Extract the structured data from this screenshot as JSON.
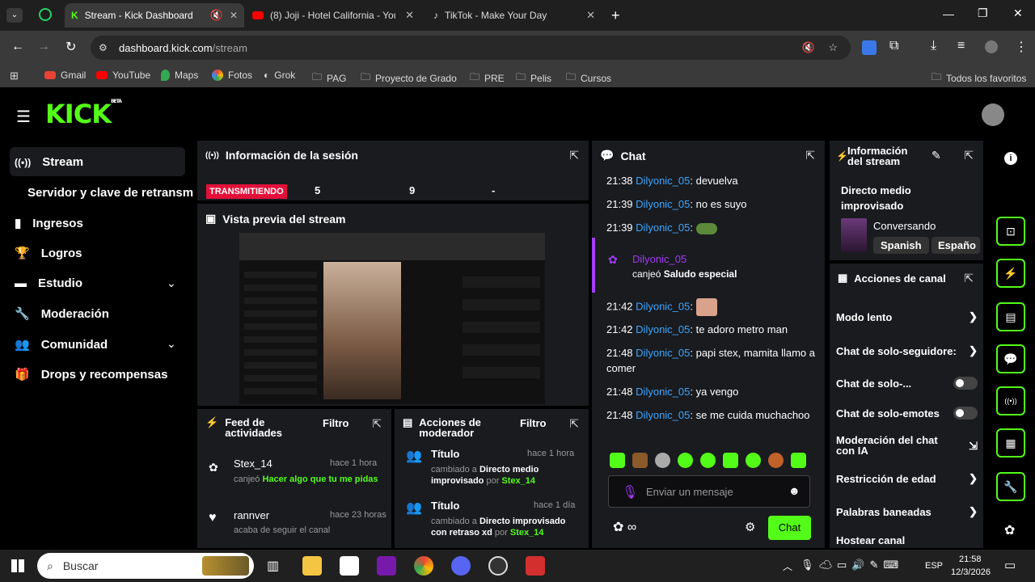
{
  "browser": {
    "tabs": [
      {
        "title": "Stream - Kick Dashboard",
        "active": true
      },
      {
        "title": "(8) Joji - Hotel California - YouT"
      },
      {
        "title": "TikTok - Make Your Day"
      }
    ],
    "url_host": "dashboard.kick.com",
    "url_path": "/stream",
    "bookmarks": [
      "Gmail",
      "YouTube",
      "Maps",
      "Fotos",
      "Grok",
      "PAG",
      "Proyecto de Grado",
      "PRE",
      "Pelis",
      "Cursos"
    ],
    "all_bookmarks": "Todos los favoritos"
  },
  "app": {
    "logo": "KICK",
    "logo_badge": "BETA"
  },
  "sidebar": {
    "items": [
      {
        "label": "Stream"
      },
      {
        "label": "Servidor y clave de retransm"
      },
      {
        "label": "Ingresos"
      },
      {
        "label": "Logros"
      },
      {
        "label": "Estudio"
      },
      {
        "label": "Moderación"
      },
      {
        "label": "Comunidad"
      },
      {
        "label": "Drops y recompensas"
      }
    ]
  },
  "session": {
    "title": "Información de la sesión",
    "status": "TRANSMITIENDO",
    "stat1": "5",
    "stat2": "9",
    "stat3": "-"
  },
  "preview": {
    "title": "Vista previa del stream"
  },
  "activity": {
    "title": "Feed de actividades",
    "filter": "Filtro",
    "items": [
      {
        "user": "Stex_14",
        "time": "hace 1 hora",
        "verb": "canjeó ",
        "reward": "Hacer algo que tu me pidas"
      },
      {
        "user": "rannver",
        "time": "hace 23 horas",
        "desc": "acaba de seguir el canal"
      }
    ]
  },
  "modactions": {
    "title": "Acciones de moderador",
    "filter": "Filtro",
    "items": [
      {
        "label": "Título",
        "time": "hace 1 hora",
        "pre": "cambiado a ",
        "value": "Directo medio improvisado",
        "by": " por ",
        "user": "Stex_14"
      },
      {
        "label": "Título",
        "time": "hace 1 día",
        "pre": "cambiado a ",
        "value": "Directo improvisado con retraso xd",
        "by": " por ",
        "user": "Stex_14"
      }
    ]
  },
  "chat": {
    "title": "Chat",
    "messages": [
      {
        "time": "21:38",
        "user": "Dilyonic_05",
        "text": ": devuelva"
      },
      {
        "time": "21:39",
        "user": "Dilyonic_05",
        "text": ": no es suyo"
      },
      {
        "time": "21:39",
        "user": "Dilyonic_05",
        "text": ":"
      },
      {
        "time": "21:42",
        "user": "Dilyonic_05",
        "text": ":"
      },
      {
        "time": "21:42",
        "user": "Dilyonic_05",
        "text": ": te adoro metro man"
      },
      {
        "time": "21:48",
        "user": "Dilyonic_05",
        "text": ": papi stex, mamita llamo a comer"
      },
      {
        "time": "21:48",
        "user": "Dilyonic_05",
        "text": ": ya vengo"
      },
      {
        "time": "21:48",
        "user": "Dilyonic_05",
        "text": ": se me cuida muchachoo"
      }
    ],
    "redeem": {
      "user": "Dilyonic_05",
      "verb": "canjeó ",
      "reward": "Saludo especial"
    },
    "placeholder": "Enviar un mensaje",
    "send": "Chat"
  },
  "streaminfo": {
    "title_line1": "Información",
    "title_line2": "del stream",
    "stream_title": "Directo medio improvisado",
    "category": "Conversando",
    "tags": [
      "Spanish",
      "Españo"
    ]
  },
  "channelactions": {
    "title": "Acciones de canal",
    "items": [
      {
        "label": "Modo lento"
      },
      {
        "label": "Chat de solo-seguidore:"
      },
      {
        "label": "Chat de solo-..."
      },
      {
        "label": "Chat de solo-emotes"
      },
      {
        "label": "Moderación del chat con IA"
      },
      {
        "label": "Restricción de edad"
      },
      {
        "label": "Palabras baneadas"
      },
      {
        "label": "Hostear canal"
      }
    ]
  },
  "taskbar": {
    "search": "Buscar",
    "lang": "ESP",
    "time": "21:58",
    "date": "12/3/2026"
  }
}
